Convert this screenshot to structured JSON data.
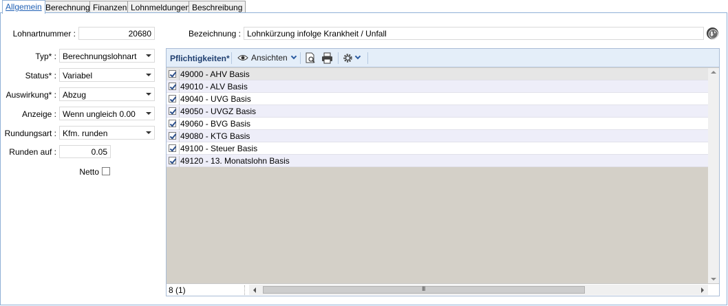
{
  "tabs": [
    {
      "label": "Allgemein"
    },
    {
      "label": "Berechnung"
    },
    {
      "label": "Finanzen"
    },
    {
      "label": "Lohnmeldungen"
    },
    {
      "label": "Beschreibung"
    }
  ],
  "form": {
    "lohnartnummer_label": "Lohnartnummer :",
    "lohnartnummer_value": "20680",
    "bezeichnung_label": "Bezeichnung :",
    "bezeichnung_value": "Lohnkürzung infolge Krankheit / Unfall",
    "typ_label": "Typ* :",
    "typ_value": "Berechnungslohnart",
    "status_label": "Status* :",
    "status_value": "Variabel",
    "auswirkung_label": "Auswirkung* :",
    "auswirkung_value": "Abzug",
    "anzeige_label": "Anzeige :",
    "anzeige_value": "Wenn ungleich 0.00",
    "rundungsart_label": "Rundungsart :",
    "rundungsart_value": "Kfm. runden",
    "runden_auf_label": "Runden auf :",
    "runden_auf_value": "0.05",
    "netto_label": "Netto",
    "netto_checked": false
  },
  "grid": {
    "title": "Pflichtigkeiten*",
    "ansichten_label": "Ansichten",
    "rows": [
      {
        "label": "49000 - AHV Basis",
        "checked": true
      },
      {
        "label": "49010 - ALV Basis",
        "checked": true
      },
      {
        "label": "49040 - UVG Basis",
        "checked": true
      },
      {
        "label": "49050 - UVGZ Basis",
        "checked": true
      },
      {
        "label": "49060 - BVG Basis",
        "checked": true
      },
      {
        "label": "49080 - KTG Basis",
        "checked": true
      },
      {
        "label": "49100 - Steuer Basis",
        "checked": true
      },
      {
        "label": "49120 - 13. Monatslohn Basis",
        "checked": true
      }
    ],
    "count": "8 (1)",
    "scroll_grip": "III"
  },
  "colors": {
    "accent": "#1e5fb4",
    "toolbar_bg": "#e4eef9",
    "grid_empty": "#d4d0c8"
  }
}
